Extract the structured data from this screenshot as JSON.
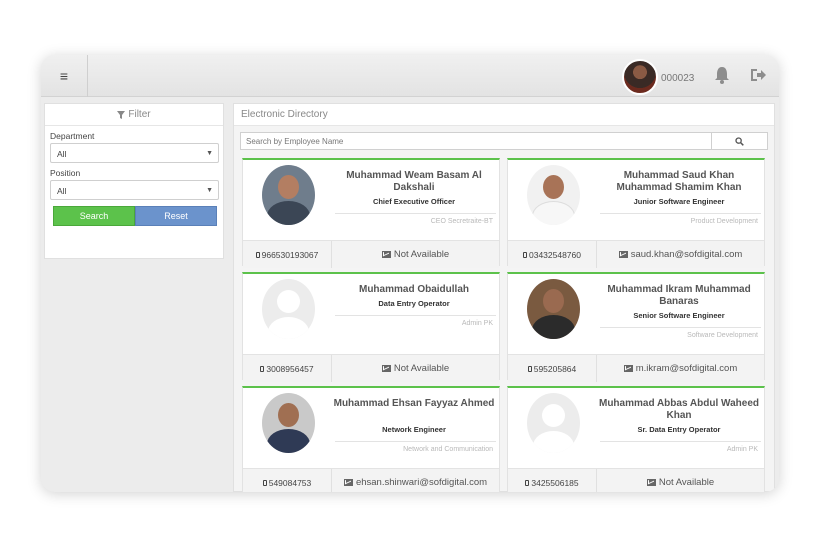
{
  "topbar": {
    "menu_icon": "hamburger-icon",
    "user_id": "000023",
    "bell_icon": "bell-icon",
    "logout_icon": "sign-out-icon"
  },
  "filter": {
    "header": "Filter",
    "department_label": "Department",
    "department_value": "All",
    "position_label": "Position",
    "position_value": "All",
    "search_label": "Search",
    "reset_label": "Reset"
  },
  "directory": {
    "title": "Electronic Directory",
    "search_placeholder": "Search by Employee Name",
    "employees": [
      {
        "name": "Muhammad Weam Basam Al Dakshali",
        "title": "Chief Executive Officer",
        "department": "CEO Secretraite-BT",
        "phone": "966530193067",
        "email": "Not Available"
      },
      {
        "name": "Muhammad Saud Khan Muhammad Shamim Khan",
        "title": "Junior Software Engineer",
        "department": "Product Development",
        "phone": "03432548760",
        "email": "saud.khan@sofdigital.com"
      },
      {
        "name": "Muhammad Obaidullah",
        "title": "Data Entry Operator",
        "department": "Admin PK",
        "phone": "3008956457",
        "email": "Not Available"
      },
      {
        "name": "Muhammad Ikram Muhammad Banaras",
        "title": "Senior Software Engineer",
        "department": "Software Development",
        "phone": "595205864",
        "email": "m.ikram@sofdigital.com"
      },
      {
        "name": "Muhammad Ehsan Fayyaz Ahmed",
        "title": "Network Engineer",
        "department": "Network and Communication",
        "phone": "549084753",
        "email": "ehsan.shinwari@sofdigital.com"
      },
      {
        "name": "Muhammad Abbas Abdul Waheed Khan",
        "title": "Sr. Data Entry Operator",
        "department": "Admin PK",
        "phone": "3425506185",
        "email": "Not Available"
      }
    ]
  },
  "colors": {
    "accent_green": "#5cc24b",
    "reset_blue": "#6b93cc"
  }
}
